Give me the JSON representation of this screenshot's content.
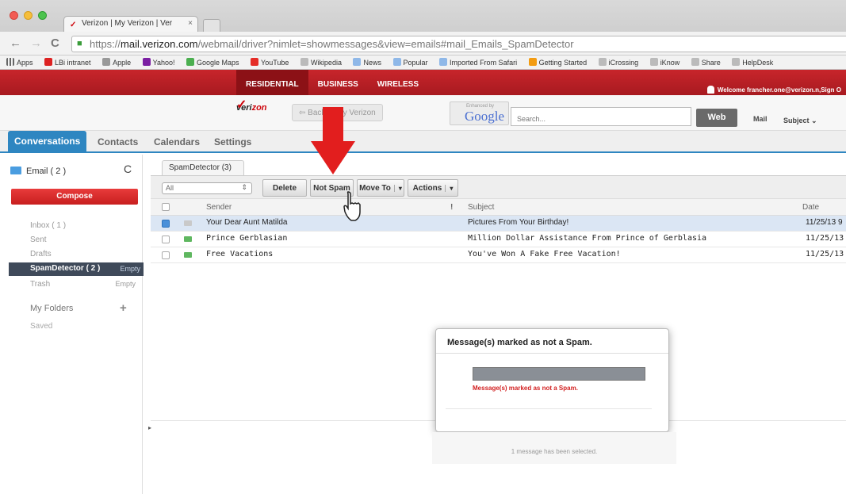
{
  "browser": {
    "tab_title": "Verizon | My Verizon | Ver",
    "tab_close": "×",
    "url_scheme": "https://",
    "url_domain": "mail.verizon.com",
    "url_path": "/webmail/driver?nimlet=showmessages&view=emails#mail_Emails_SpamDetector",
    "back": "←",
    "forward": "→",
    "reload": "C",
    "bookmarks": [
      "Apps",
      "LBi intranet",
      "Apple",
      "Yahoo!",
      "Google Maps",
      "YouTube",
      "Wikipedia",
      "News",
      "Popular",
      "Imported From Safari",
      "Getting Started",
      "iCrossing",
      "iKnow",
      "Share",
      "HelpDesk"
    ]
  },
  "site": {
    "segments": [
      "RESIDENTIAL",
      "BUSINESS",
      "WIRELESS"
    ],
    "welcome": "Welcome francher.one@verizon.n,Sign O",
    "logo_a": "veri",
    "logo_b": "zon",
    "logo_check": "✓",
    "back_btn": "⇦ Back to My Verizon",
    "enhanced_by": "Enhanced by",
    "google": "Google",
    "search_placeholder": "Search...",
    "web_btn": "Web",
    "mail_opt": "Mail",
    "subject_opt": "Subject ⌄"
  },
  "nav": {
    "tabs": [
      "Conversations",
      "Contacts",
      "Calendars",
      "Settings"
    ]
  },
  "sidebar": {
    "email": "Email ( 2 )",
    "refresh": "C",
    "compose": "Compose",
    "inbox": "Inbox ( 1 )",
    "sent": "Sent",
    "drafts": "Drafts",
    "spam": "SpamDetector ( 2 )",
    "spam_empty": "Empty",
    "trash": "Trash",
    "trash_empty": "Empty",
    "my_folders": "My Folders",
    "plus": "+",
    "saved": "Saved"
  },
  "content": {
    "folder_tab": "SpamDetector (3)",
    "select_value": "All",
    "select_caret": "⇕",
    "delete": "Delete",
    "not_spam": "Not Spam",
    "move_to": "Move To",
    "actions": "Actions",
    "dd": "▾",
    "col_sender": "Sender",
    "col_flag": "!",
    "col_subject": "Subject",
    "col_date": "Date",
    "rows": [
      {
        "sender": "Your Dear Aunt Matilda",
        "subject": "Pictures From Your Birthday!",
        "date": "11/25/13 9"
      },
      {
        "sender": "Prince Gerblasian",
        "subject": "Million Dollar Assistance From Prince of Gerblasia",
        "date": "11/25/13"
      },
      {
        "sender": "Free Vacations",
        "subject": "You've Won A Fake Free Vacation!",
        "date": "11/25/13"
      }
    ]
  },
  "dialog": {
    "title": "Message(s) marked as not a Spam.",
    "message": "Message(s) marked as not a Spam."
  },
  "status": {
    "selected": "1 message has been selected."
  },
  "colors": {
    "verizon_red": "#c8252b",
    "accent_blue": "#2e86c1",
    "arrow_red": "#e21e1e"
  }
}
